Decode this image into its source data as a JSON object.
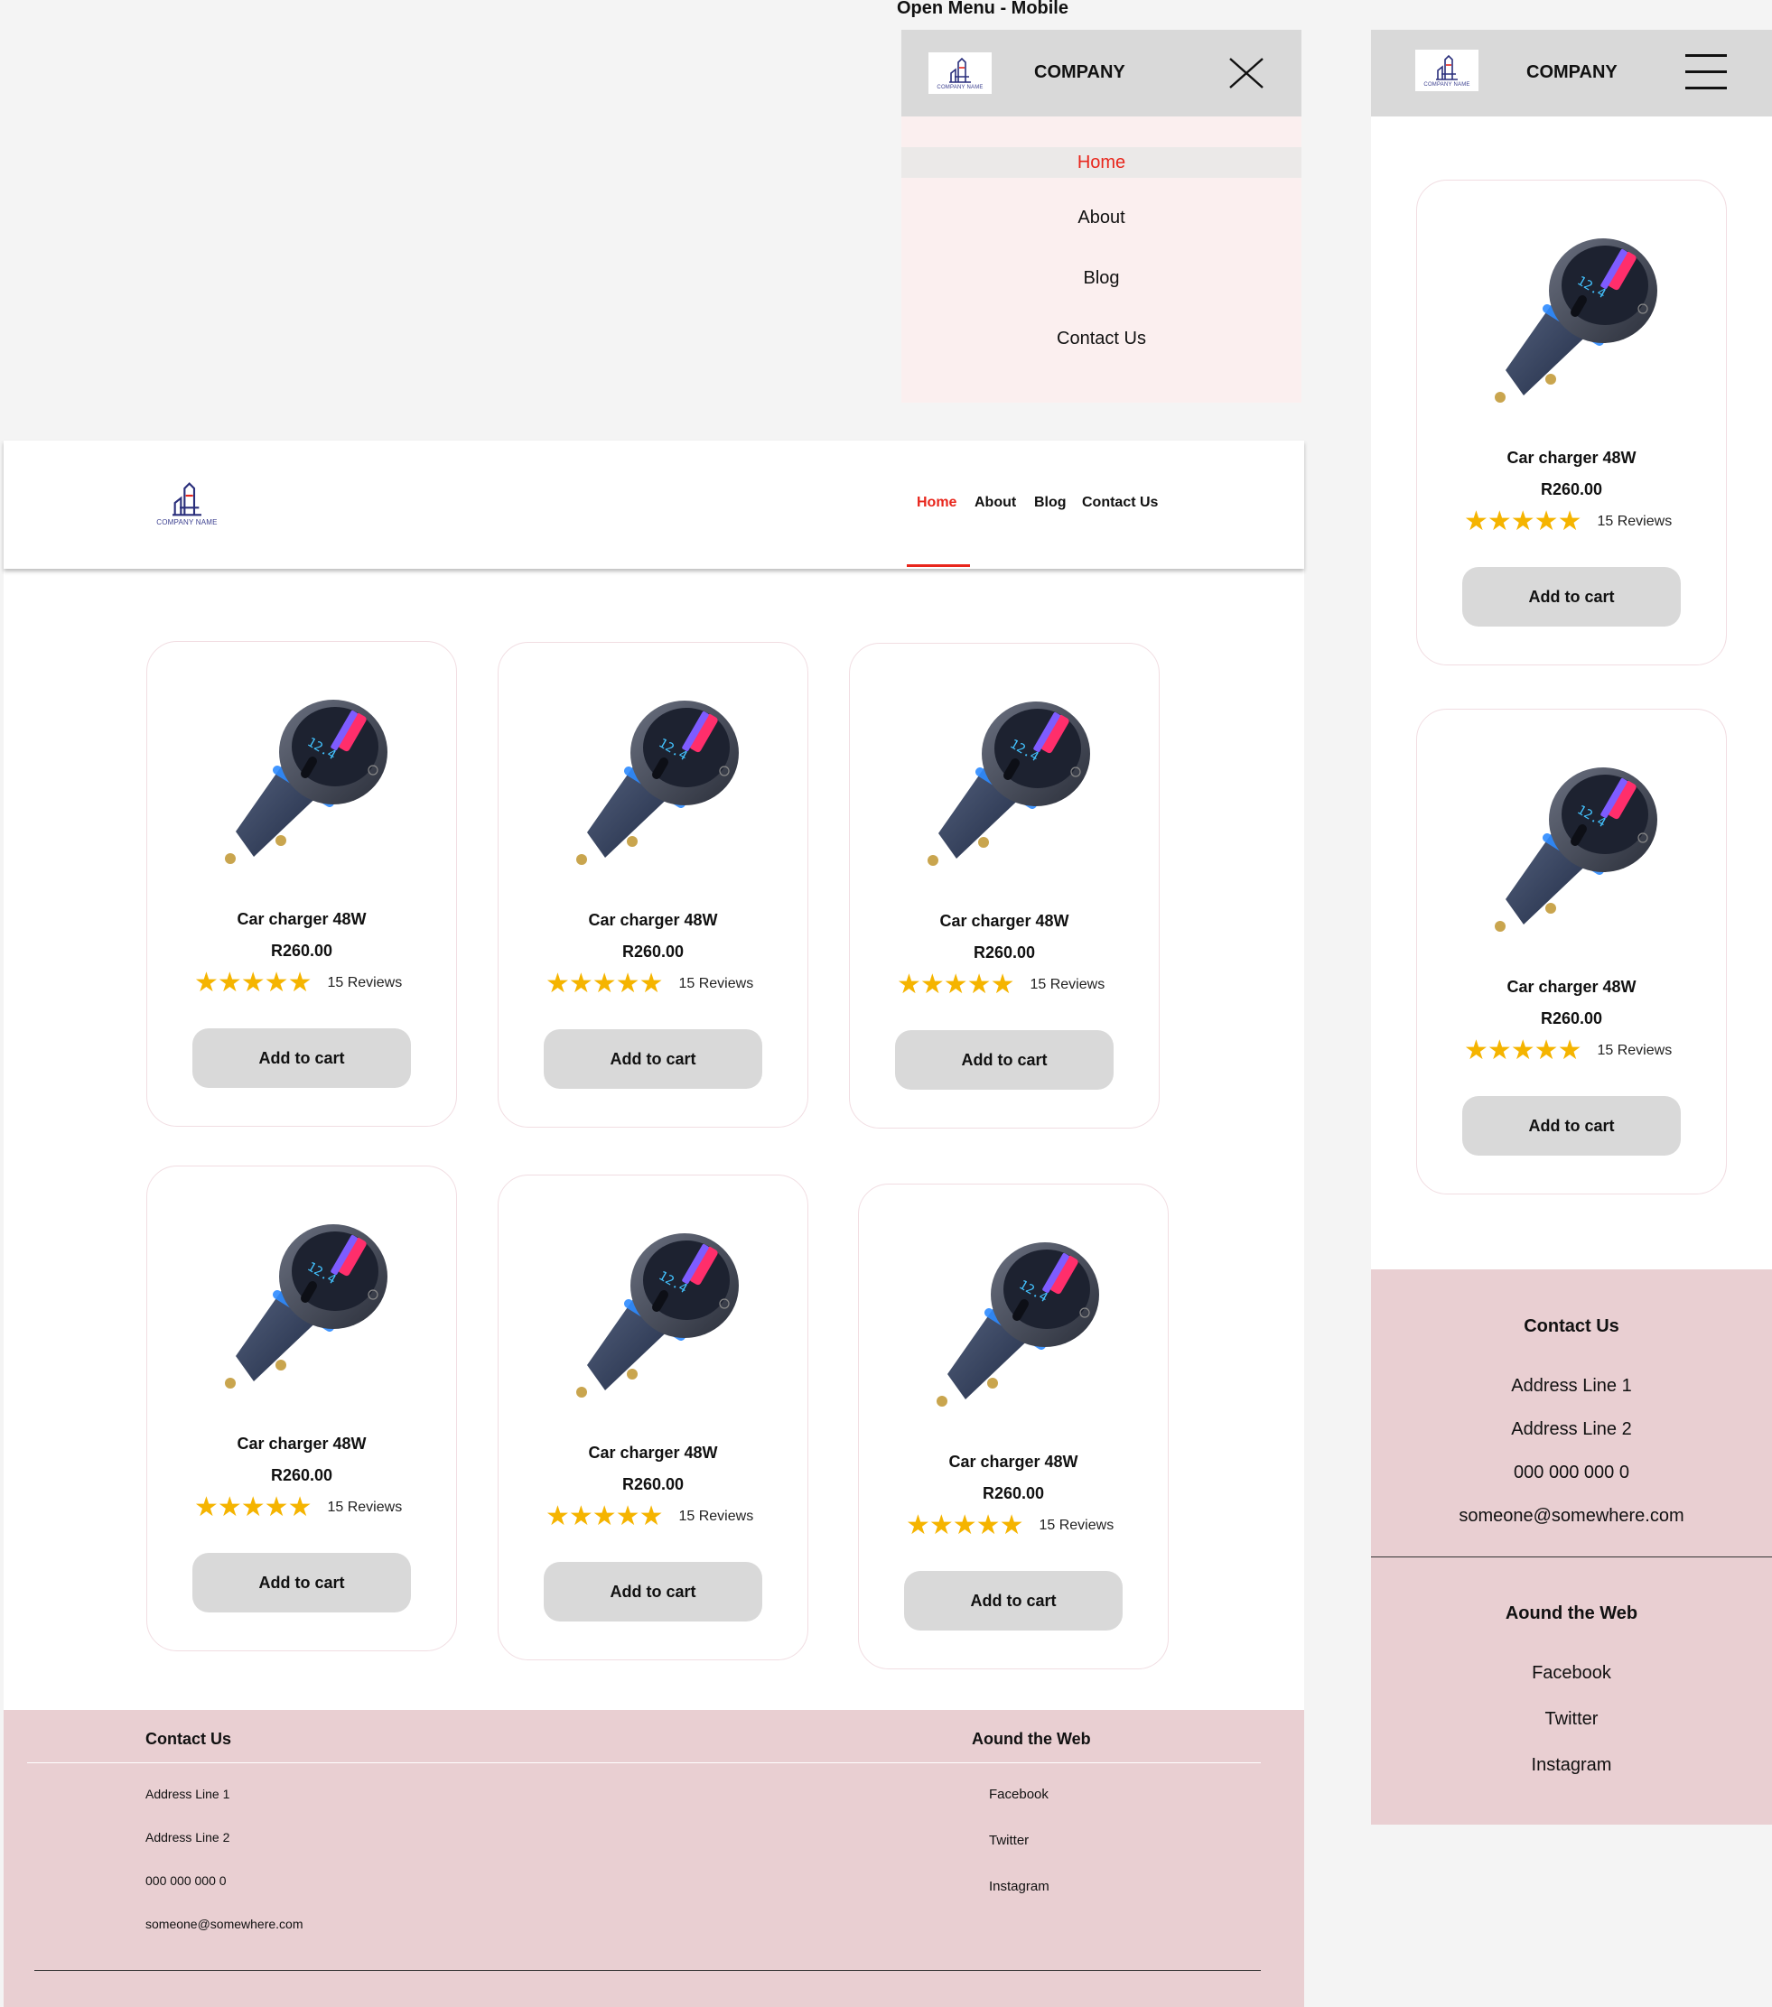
{
  "frame_label": "Open Menu - Mobile",
  "brand": {
    "company": "COMPANY",
    "logo_text": "COMPANY NAME"
  },
  "nav": {
    "items": [
      "Home",
      "About",
      "Blog",
      "Contact Us"
    ],
    "active": "Home"
  },
  "product": {
    "name": "Car charger 48W",
    "price": "R260.00",
    "stars": "★★★★★",
    "rating": 5,
    "reviews": "15 Reviews",
    "cta": "Add to cart"
  },
  "footer": {
    "contact_title": "Contact Us",
    "contact": [
      "Address Line 1",
      "Address Line 2",
      "000 000 000 0",
      "someone@somewhere.com"
    ],
    "web_title": "Aound the Web",
    "web": [
      "Facebook",
      "Twitter",
      "Instagram"
    ]
  },
  "colors": {
    "accent": "#e8261c",
    "menu_bg": "#fbefef",
    "footer_bg": "#e9cfd2",
    "header_gray": "#d9d9d9",
    "button_gray": "#d9d9d9",
    "star": "#f5b400"
  },
  "icons": [
    "logo-icon",
    "close-icon",
    "hamburger-icon",
    "star-icon",
    "car-charger-image"
  ]
}
